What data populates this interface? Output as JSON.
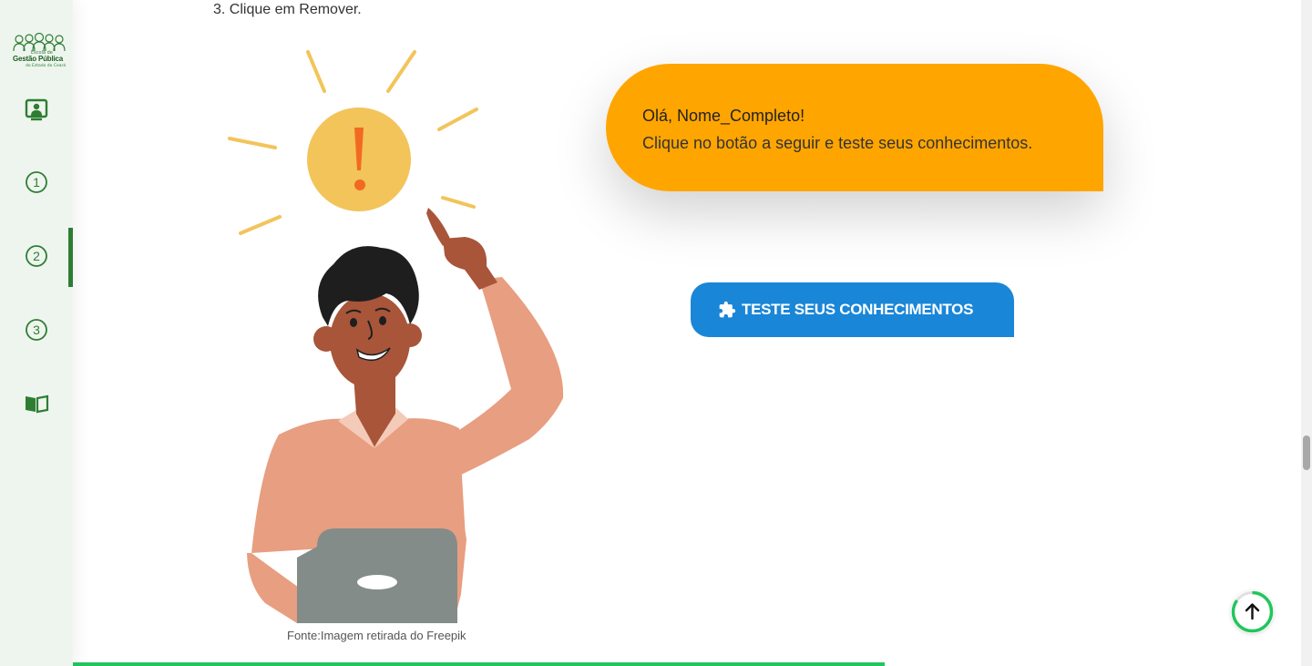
{
  "sidebar": {
    "logo": {
      "top": "Escola de",
      "main": "Gestão Pública",
      "sub": "do Estado do Ceará"
    },
    "items": [
      {
        "name": "presentation",
        "icon": "presentation-icon"
      },
      {
        "name": "module-1",
        "icon": "circle-number-1-icon",
        "label": "1"
      },
      {
        "name": "module-2",
        "icon": "circle-number-2-icon",
        "label": "2",
        "active": true
      },
      {
        "name": "module-3",
        "icon": "circle-number-3-icon",
        "label": "3"
      },
      {
        "name": "library",
        "icon": "book-open-icon"
      }
    ],
    "accent": "#2e7d32"
  },
  "content": {
    "instruction": "3. Clique em Remover.",
    "illustration_icon": "person-idea-illustration",
    "caption": "Fonte:Imagem retirada do Freepik",
    "bubble": {
      "greeting": "Olá, Nome_Completo!",
      "message": "Clique no botão a seguir e teste seus conhecimentos.",
      "color": "#ffa500"
    },
    "test_button": {
      "label": "TESTE SEUS CONHECIMENTOS",
      "icon": "puzzle-icon",
      "color": "#1a86d8"
    }
  },
  "progress": {
    "value": 0.661,
    "color": "#22c55e"
  },
  "back_to_top": {
    "icon": "arrow-up-icon",
    "progress": 0.85
  }
}
